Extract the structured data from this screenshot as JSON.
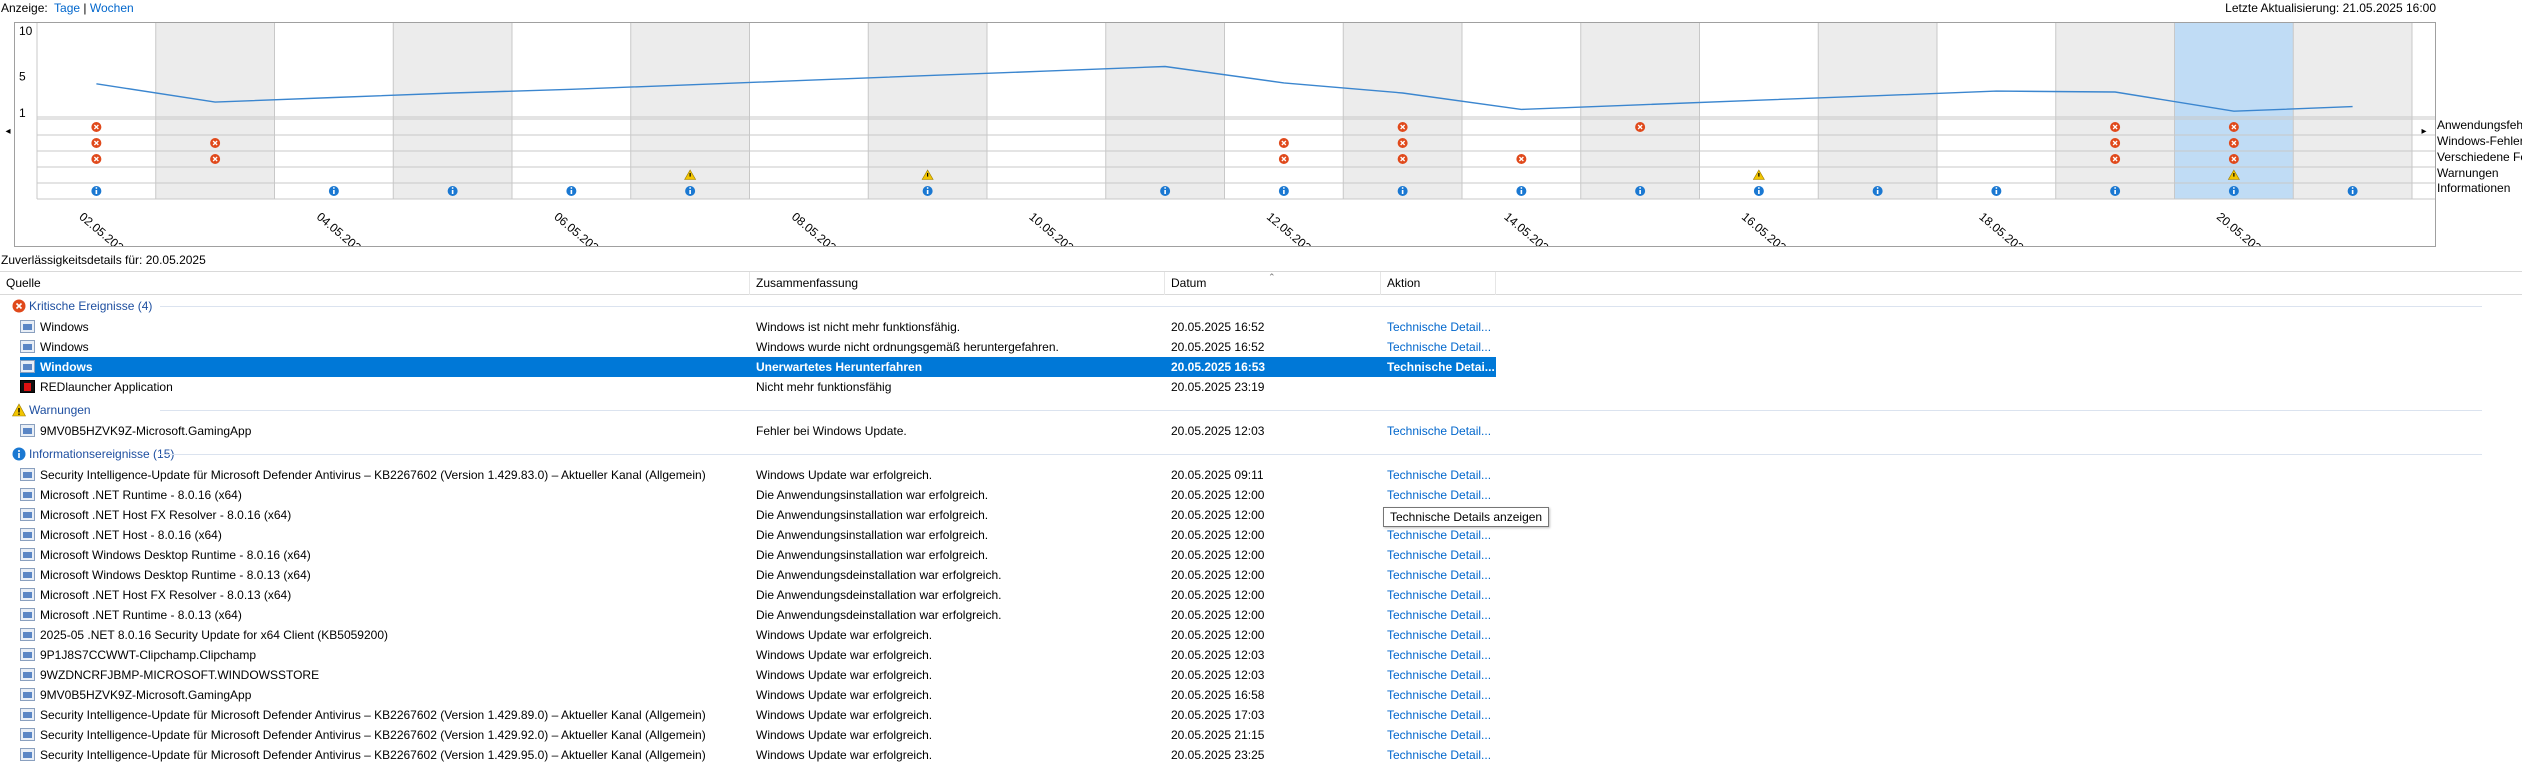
{
  "header": {
    "view_label": "Anzeige:",
    "view_days": "Tage",
    "view_separator": "|",
    "view_weeks": "Wochen",
    "last_update": "Letzte Aktualisierung: 21.05.2025 16:00"
  },
  "chart_data": {
    "type": "line",
    "y_ticks": [
      "10",
      "5",
      "1"
    ],
    "ylim": [
      1,
      10
    ],
    "dates": [
      "02.05.2025",
      "03.05.2025",
      "04.05.2025",
      "05.05.2025",
      "06.05.2025",
      "07.05.2025",
      "08.05.2025",
      "09.05.2025",
      "10.05.2025",
      "11.05.2025",
      "12.05.2025",
      "13.05.2025",
      "14.05.2025",
      "15.05.2025",
      "16.05.2025",
      "17.05.2025",
      "18.05.2025",
      "19.05.2025",
      "20.05.2025",
      "21.05.2025"
    ],
    "date_labels": [
      "02.05.2025",
      "04.05.2025",
      "06.05.2025",
      "08.05.2025",
      "10.05.2025",
      "12.05.2025",
      "14.05.2025",
      "16.05.2025",
      "18.05.2025",
      "20.05.2025"
    ],
    "selected_date": "20.05.2025",
    "stability_index": [
      4.2,
      2.2,
      2.7,
      3.2,
      3.6,
      4.1,
      4.6,
      5.1,
      5.6,
      6.1,
      4.3,
      3.2,
      1.4,
      1.9,
      2.4,
      2.9,
      3.4,
      3.3,
      1.2,
      1.7
    ],
    "line_color": "#3b86cf",
    "legend": [
      "Anwendungsfeh",
      "Windows-Fehler",
      "Verschiedene Fe",
      "Warnungen",
      "Informationen"
    ],
    "events": {
      "app_errors": [
        "02.05.2025",
        "13.05.2025",
        "15.05.2025",
        "19.05.2025",
        "20.05.2025"
      ],
      "windows_errors": [
        "02.05.2025",
        "03.05.2025",
        "12.05.2025",
        "13.05.2025",
        "19.05.2025",
        "20.05.2025"
      ],
      "misc_errors": [
        "02.05.2025",
        "03.05.2025",
        "12.05.2025",
        "13.05.2025",
        "14.05.2025",
        "19.05.2025",
        "20.05.2025"
      ],
      "warnings": [
        "07.05.2025",
        "09.05.2025",
        "16.05.2025",
        "20.05.2025"
      ],
      "info": [
        "02.05.2025",
        "04.05.2025",
        "05.05.2025",
        "06.05.2025",
        "07.05.2025",
        "09.05.2025",
        "11.05.2025",
        "12.05.2025",
        "13.05.2025",
        "14.05.2025",
        "15.05.2025",
        "16.05.2025",
        "17.05.2025",
        "18.05.2025",
        "19.05.2025",
        "20.05.2025",
        "21.05.2025"
      ]
    },
    "colors": {
      "error": "#e0491b",
      "warning": "#f2c500",
      "info": "#1a78d2",
      "shade": "#ececec",
      "selected": "#c0dcf5"
    }
  },
  "details": {
    "title": "Zuverlässigkeitsdetails für: 20.05.2025",
    "columns": [
      "Quelle",
      "Zusammenfassung",
      "Datum",
      "Aktion"
    ],
    "groups": [
      {
        "label": "Kritische Ereignisse (4)",
        "icon": "error-icon",
        "rows": [
          {
            "source": "Windows",
            "summary": "Windows ist nicht mehr funktionsfähig.",
            "date": "20.05.2025 16:52",
            "action": "Technische Detail..."
          },
          {
            "source": "Windows",
            "summary": "Windows wurde nicht ordnungsgemäß heruntergefahren.",
            "date": "20.05.2025 16:52",
            "action": "Technische Detail..."
          },
          {
            "source": "Windows",
            "summary": "Unerwartetes Herunterfahren",
            "date": "20.05.2025 16:53",
            "action": "Technische Detai...",
            "selected": true
          },
          {
            "source": "REDlauncher Application",
            "summary": "Nicht mehr funktionsfähig",
            "date": "20.05.2025 23:19",
            "action": "",
            "icon": "red"
          }
        ]
      },
      {
        "label": "Warnungen",
        "icon": "warning-icon",
        "rows": [
          {
            "source": "9MV0B5HZVK9Z-Microsoft.GamingApp",
            "summary": "Fehler bei Windows Update.",
            "date": "20.05.2025 12:03",
            "action": "Technische Detail..."
          }
        ]
      },
      {
        "label": "Informationsereignisse (15)",
        "icon": "info-icon",
        "rows": [
          {
            "source": "Security Intelligence-Update für Microsoft Defender Antivirus – KB2267602 (Version 1.429.83.0) – Aktueller Kanal (Allgemein)",
            "summary": "Windows Update war erfolgreich.",
            "date": "20.05.2025 09:11",
            "action": "Technische Detail..."
          },
          {
            "source": "Microsoft .NET Runtime - 8.0.16 (x64)",
            "summary": "Die Anwendungsinstallation war erfolgreich.",
            "date": "20.05.2025 12:00",
            "action": "Technische Detail..."
          },
          {
            "source": "Microsoft .NET Host FX Resolver - 8.0.16 (x64)",
            "summary": "Die Anwendungsinstallation war erfolgreich.",
            "date": "20.05.2025 12:00",
            "action": "Technische Detail..."
          },
          {
            "source": "Microsoft .NET Host - 8.0.16 (x64)",
            "summary": "Die Anwendungsinstallation war erfolgreich.",
            "date": "20.05.2025 12:00",
            "action": "Technische Detail..."
          },
          {
            "source": "Microsoft Windows Desktop Runtime - 8.0.16 (x64)",
            "summary": "Die Anwendungsinstallation war erfolgreich.",
            "date": "20.05.2025 12:00",
            "action": "Technische Detail..."
          },
          {
            "source": "Microsoft Windows Desktop Runtime - 8.0.13 (x64)",
            "summary": "Die Anwendungsdeinstallation war erfolgreich.",
            "date": "20.05.2025 12:00",
            "action": "Technische Detail..."
          },
          {
            "source": "Microsoft .NET Host FX Resolver - 8.0.13 (x64)",
            "summary": "Die Anwendungsdeinstallation war erfolgreich.",
            "date": "20.05.2025 12:00",
            "action": "Technische Detail..."
          },
          {
            "source": "Microsoft .NET Runtime - 8.0.13 (x64)",
            "summary": "Die Anwendungsdeinstallation war erfolgreich.",
            "date": "20.05.2025 12:00",
            "action": "Technische Detail..."
          },
          {
            "source": "2025-05 .NET 8.0.16 Security Update for x64 Client (KB5059200)",
            "summary": "Windows Update war erfolgreich.",
            "date": "20.05.2025 12:00",
            "action": "Technische Detail..."
          },
          {
            "source": "9P1J8S7CCWWT-Clipchamp.Clipchamp",
            "summary": "Windows Update war erfolgreich.",
            "date": "20.05.2025 12:03",
            "action": "Technische Detail..."
          },
          {
            "source": "9WZDNCRFJBMP-MICROSOFT.WINDOWSSTORE",
            "summary": "Windows Update war erfolgreich.",
            "date": "20.05.2025 12:03",
            "action": "Technische Detail..."
          },
          {
            "source": "9MV0B5HZVK9Z-Microsoft.GamingApp",
            "summary": "Windows Update war erfolgreich.",
            "date": "20.05.2025 16:58",
            "action": "Technische Detail..."
          },
          {
            "source": "Security Intelligence-Update für Microsoft Defender Antivirus – KB2267602 (Version 1.429.89.0) – Aktueller Kanal (Allgemein)",
            "summary": "Windows Update war erfolgreich.",
            "date": "20.05.2025 17:03",
            "action": "Technische Detail..."
          },
          {
            "source": "Security Intelligence-Update für Microsoft Defender Antivirus – KB2267602 (Version 1.429.92.0) – Aktueller Kanal (Allgemein)",
            "summary": "Windows Update war erfolgreich.",
            "date": "20.05.2025 21:15",
            "action": "Technische Detail..."
          },
          {
            "source": "Security Intelligence-Update für Microsoft Defender Antivirus – KB2267602 (Version 1.429.95.0) – Aktueller Kanal (Allgemein)",
            "summary": "Windows Update war erfolgreich.",
            "date": "20.05.2025 23:25",
            "action": "Technische Detail..."
          }
        ]
      }
    ]
  },
  "tooltip": {
    "text": "Technische Details anzeigen"
  }
}
